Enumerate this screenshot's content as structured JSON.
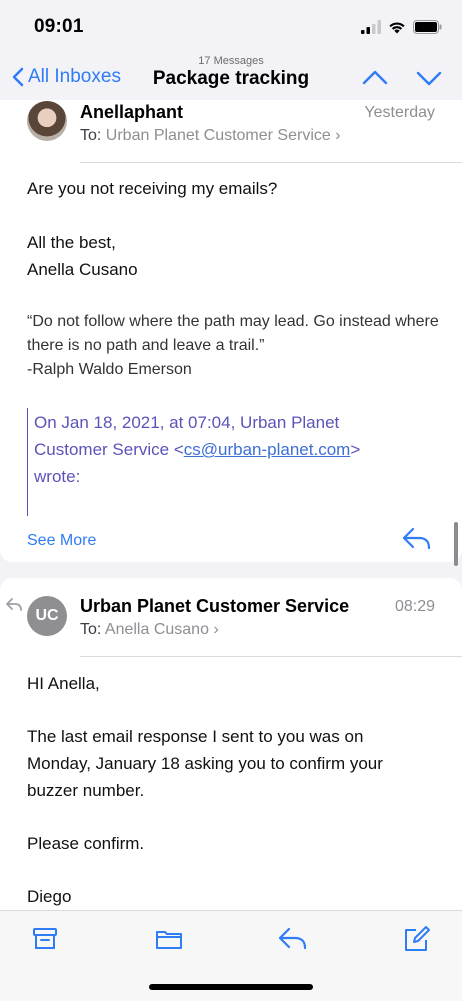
{
  "status": {
    "time": "09:01"
  },
  "nav": {
    "subtitle": "17 Messages",
    "back_label": "All Inboxes",
    "title": "Package tracking"
  },
  "message1": {
    "sender": "Anellaphant",
    "to_label": "To:",
    "to": "Urban Planet Customer Service",
    "when": "Yesterday",
    "body": [
      "Are you not receiving my emails?",
      "All the best,",
      "Anella Cusano"
    ],
    "quote": "“Do not follow where the path may lead. Go instead where there is no path and leave a trail.”",
    "quote_author": "-Ralph Waldo Emerson",
    "quoted_header_1": "On Jan 18, 2021, at 07:04, Urban Planet",
    "quoted_header_2_prefix": "Customer Service <",
    "quoted_email": "cs@urban-planet.com",
    "quoted_header_2_suffix": ">",
    "quoted_header_3": "wrote:",
    "see_more": "See More"
  },
  "message2": {
    "avatar_initials": "UC",
    "sender": "Urban Planet Customer Service",
    "to_label": "To:",
    "to": "Anella Cusano",
    "when": "08:29",
    "greeting": "HI Anella,",
    "paragraph_lines": [
      "The last email response I sent to you was on",
      "Monday, January 18 asking you to confirm your",
      "buzzer number."
    ],
    "confirm": "Please confirm.",
    "signature": "Diego"
  },
  "toolbar": {
    "icons": [
      "archive-icon",
      "folder-icon",
      "reply-icon",
      "compose-icon"
    ]
  },
  "colors": {
    "accent": "#2f7cf6",
    "quoted": "#5b54b8"
  }
}
